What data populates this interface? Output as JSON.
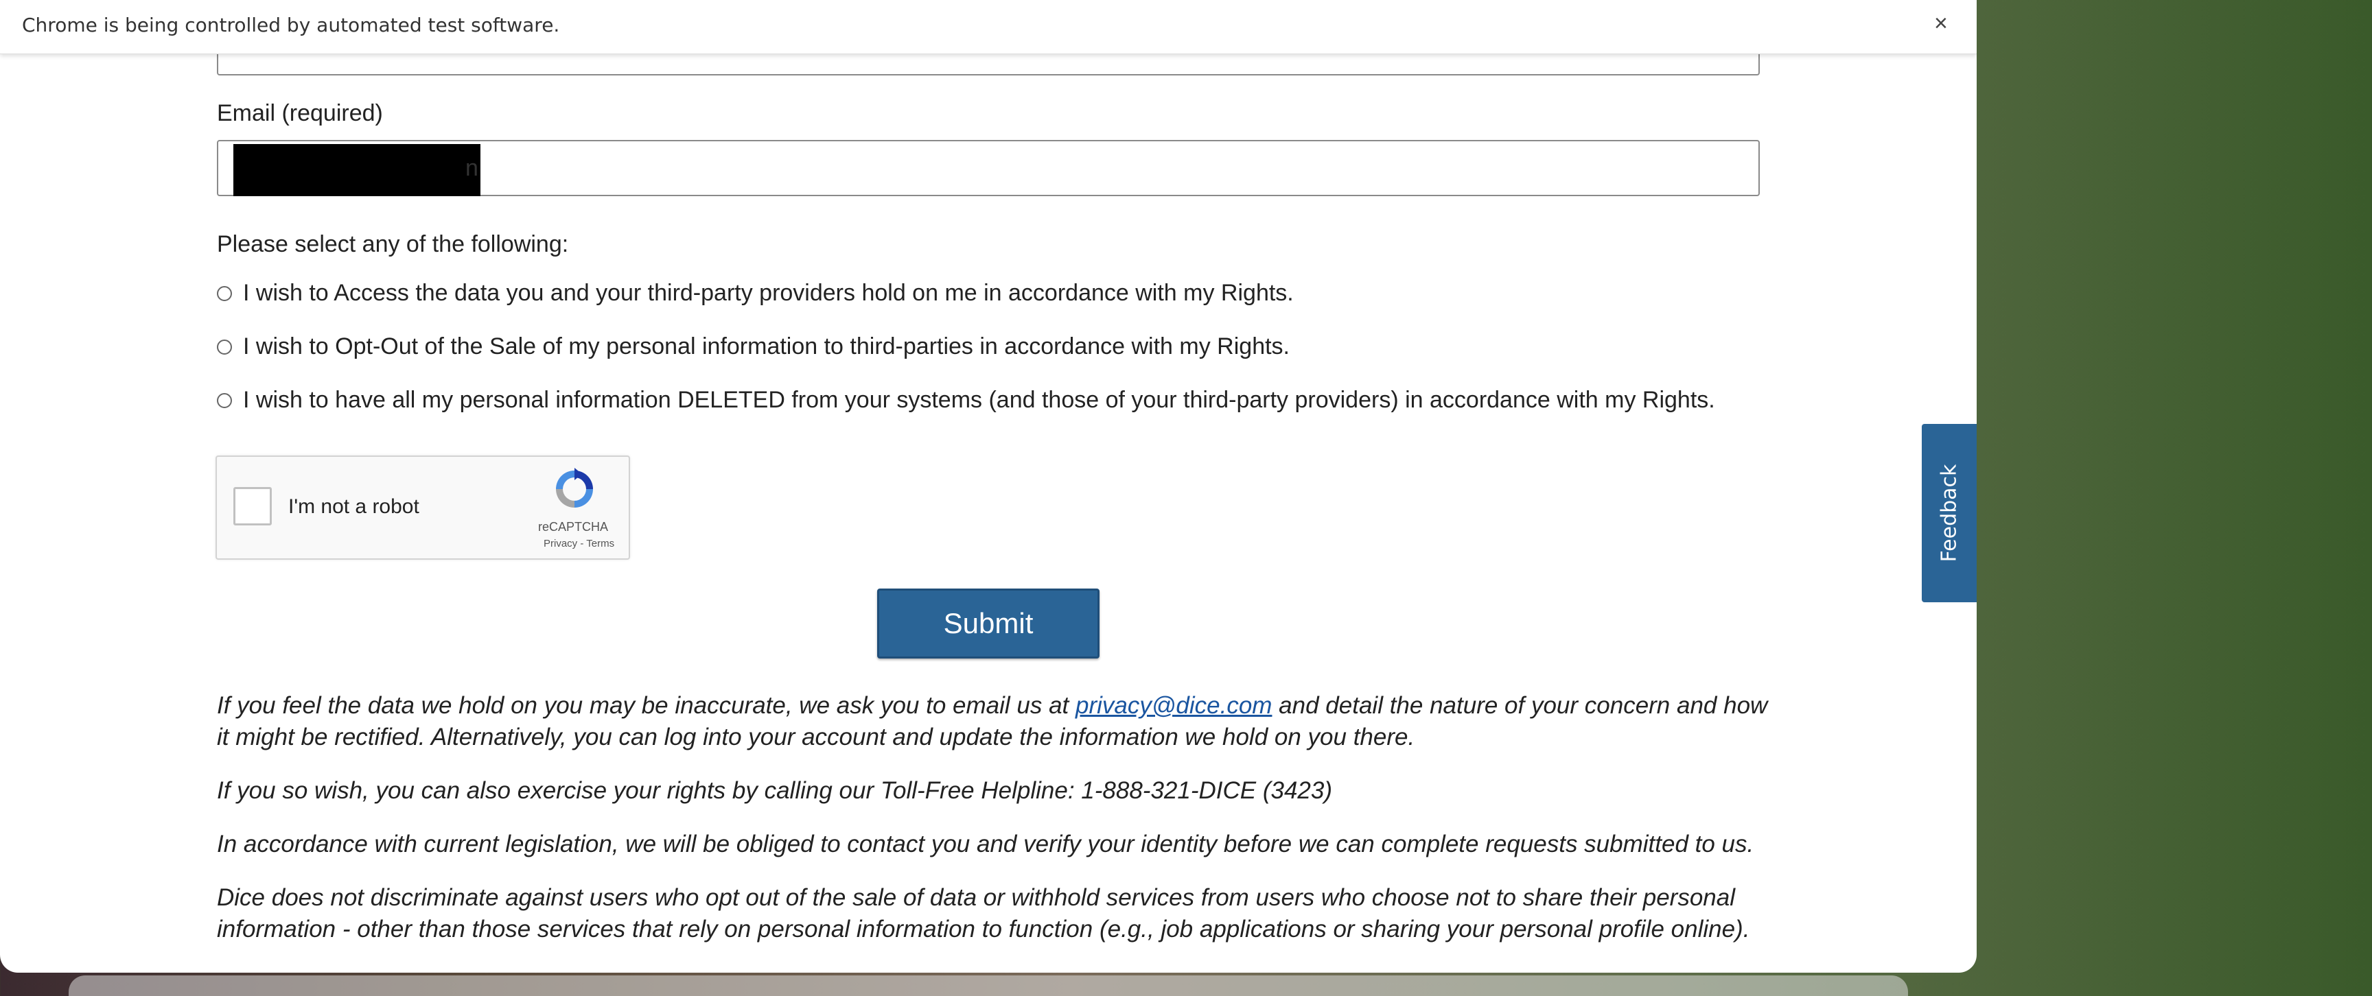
{
  "infobar": {
    "message": "Chrome is being controlled by automated test software.",
    "close_symbol": "×"
  },
  "email": {
    "label": "Email (required)",
    "value_tail": "n"
  },
  "rights": {
    "prompt": "Please select any of the following:",
    "options": [
      {
        "label": "I wish to Access the data you and your third-party providers hold on me in accordance with my Rights."
      },
      {
        "label": "I wish to Opt-Out of the Sale of my personal information to third-parties in accordance with my Rights."
      },
      {
        "label": "I wish to have all my personal information DELETED from your systems (and those of your third-party providers) in accordance with my Rights."
      }
    ]
  },
  "recaptcha": {
    "label": "I'm not a robot",
    "brand": "reCAPTCHA",
    "links": "Privacy - Terms"
  },
  "submit": {
    "label": "Submit"
  },
  "info": {
    "p1_before": "If you feel the data we hold on you may be inaccurate, we ask you to email us at ",
    "p1_link": "privacy@dice.com",
    "p1_after": " and detail the nature of your concern and how it might be rectified. Alternatively, you can log into your account and update the information we hold on you there.",
    "p2": "If you so wish, you can also exercise your rights by calling our Toll-Free Helpline: 1-888-321-DICE (3423)",
    "p3": "In accordance with current legislation, we will be obliged to contact you and verify your identity before we can complete requests submitted to us.",
    "p4": "Dice does not discriminate against users who opt out of the sale of data or withhold services from users who choose not to share their personal information - other than those services that rely on personal information to function (e.g., job applications or sharing your personal profile online)."
  },
  "feedback": {
    "label": "Feedback"
  },
  "colors": {
    "accent": "#2a6496",
    "link": "#1a55a0"
  },
  "icons": {
    "infobar_close": "close-icon",
    "recaptcha_logo": "recaptcha-logo-icon"
  }
}
